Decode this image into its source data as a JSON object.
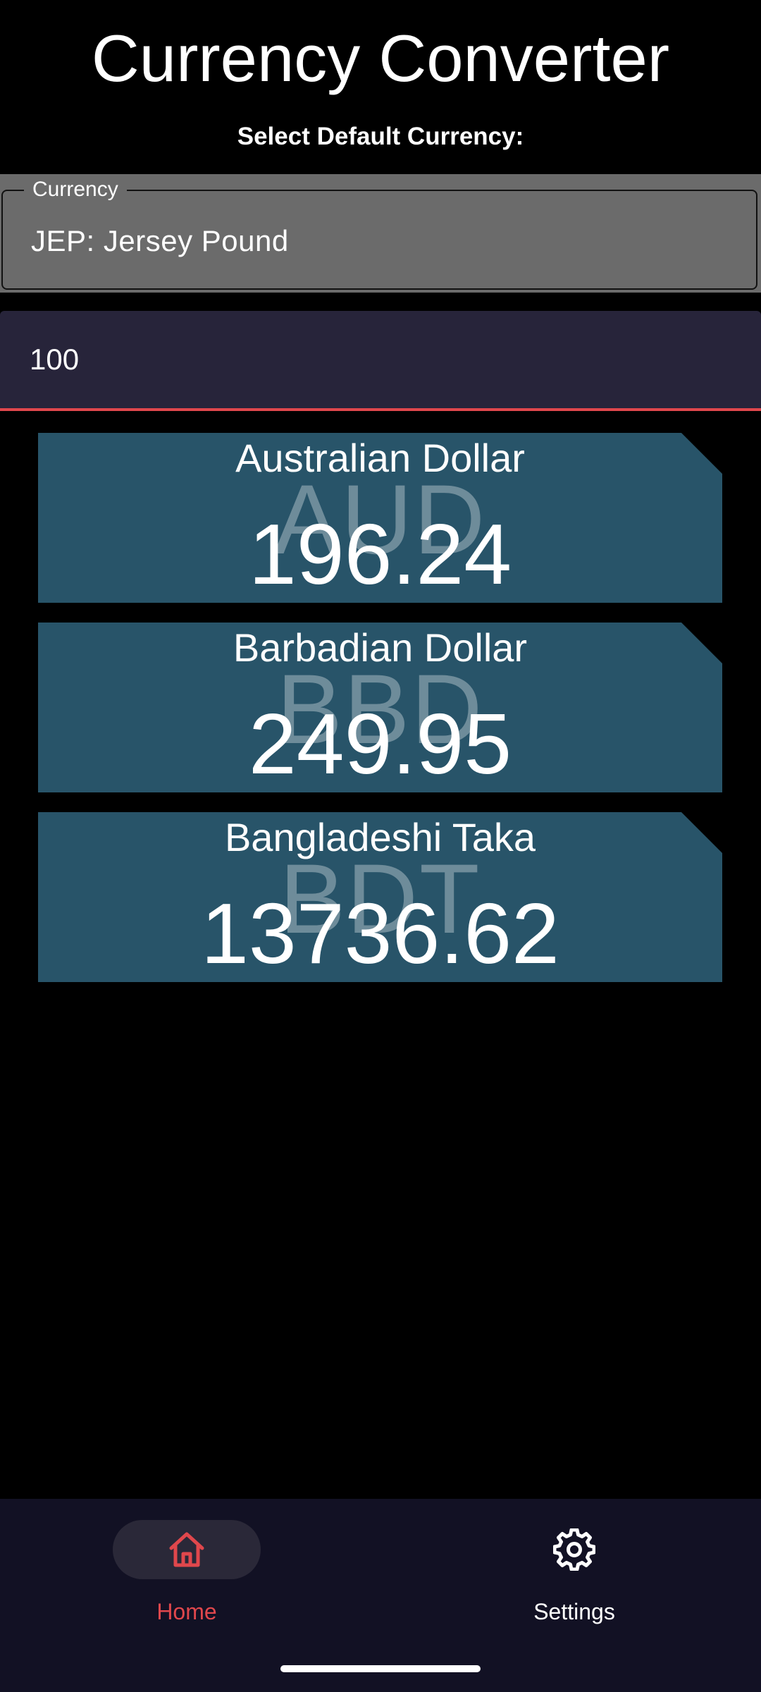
{
  "header": {
    "title": "Currency Converter",
    "subtitle": "Select Default Currency:"
  },
  "currency_select": {
    "label": "Currency",
    "value": "JEP: Jersey Pound"
  },
  "amount": {
    "value": "100"
  },
  "conversions": [
    {
      "name": "Australian Dollar",
      "code": "AUD",
      "value": "196.24"
    },
    {
      "name": "Barbadian Dollar",
      "code": "BBD",
      "value": "249.95"
    },
    {
      "name": "Bangladeshi Taka",
      "code": "BDT",
      "value": "13736.62"
    }
  ],
  "bottom_nav": {
    "items": [
      {
        "label": "Home",
        "icon": "home-icon",
        "active": true
      },
      {
        "label": "Settings",
        "icon": "gear-icon",
        "active": false
      }
    ]
  },
  "colors": {
    "background": "#000000",
    "card": "#285469",
    "accent": "#e0474c",
    "amount_field": "#27243a",
    "select_field": "#6b6b6b",
    "nav_bar": "#121124"
  }
}
